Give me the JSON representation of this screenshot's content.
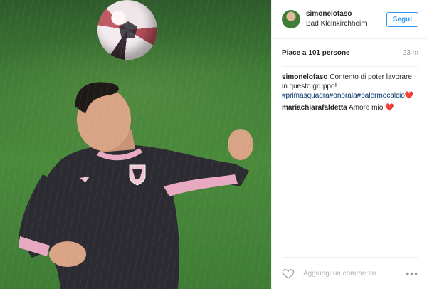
{
  "post": {
    "header": {
      "username": "simonelofaso",
      "location": "Bad Kleinkirchheim",
      "follow_label": "Segui"
    },
    "likes": "Piace a 101 persone",
    "time_ago": "23 m",
    "caption": {
      "user": "simonelofaso",
      "text": "Contento di poter lavorare in questo gruppo!",
      "hashtags": [
        "#primasquadra",
        "#onorala",
        "#palermocalcio"
      ],
      "heart": "❤️"
    },
    "comments": [
      {
        "user": "mariachiarafaldetta",
        "text": "Amore mio!",
        "heart": "❤️"
      }
    ],
    "footer": {
      "comment_placeholder": "Aggiungi un commento...",
      "more_glyph": "•••"
    }
  },
  "colors": {
    "accent": "#3897f0",
    "hashtag": "#003569",
    "heart": "#e0245e",
    "muted": "#999999",
    "divider": "#efefef"
  },
  "icons": {
    "like": "heart-outline-icon",
    "more": "more-horizontal-icon",
    "avatar": "user-avatar"
  }
}
